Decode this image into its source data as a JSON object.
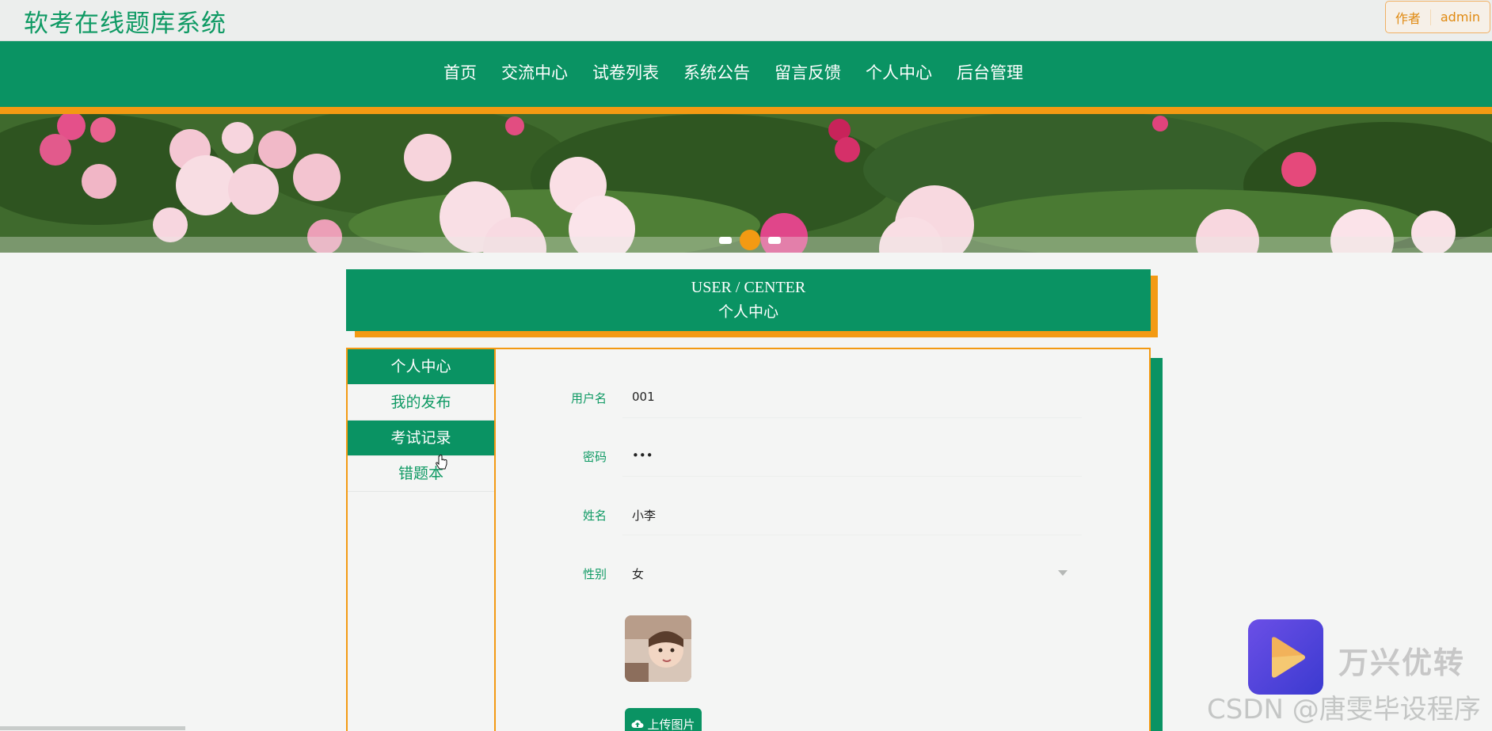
{
  "header": {
    "site_title": "软考在线题库系统",
    "author_label": "作者",
    "author_name": "admin"
  },
  "nav": {
    "items": [
      "首页",
      "交流中心",
      "试卷列表",
      "系统公告",
      "留言反馈",
      "个人中心",
      "后台管理"
    ]
  },
  "center": {
    "title_en": "USER / CENTER",
    "title_cn": "个人中心"
  },
  "sidebar": {
    "items": [
      "个人中心",
      "我的发布",
      "考试记录",
      "错题本"
    ]
  },
  "form": {
    "username_label": "用户名",
    "username_value": "001",
    "password_label": "密码",
    "password_value": "•••",
    "name_label": "姓名",
    "name_value": "小李",
    "gender_label": "性别",
    "gender_value": "女",
    "upload_label": "上传图片"
  },
  "watermark": {
    "app": "万兴优转",
    "csdn": "CSDN @唐雯毕设程序"
  },
  "colors": {
    "primary": "#0a9363",
    "accent": "#f39a13",
    "title": "#0f9a64"
  }
}
